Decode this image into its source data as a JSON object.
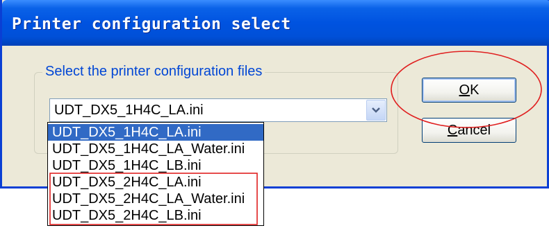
{
  "window": {
    "title": "Printer configuration select"
  },
  "group": {
    "legend": "Select the printer configuration files"
  },
  "combo": {
    "selected_value": "UDT_DX5_1H4C_LA.ini",
    "arrow_icon": "chevron-down-icon"
  },
  "dropdown": {
    "items": [
      {
        "label": "UDT_DX5_1H4C_LA.ini",
        "selected": true
      },
      {
        "label": "UDT_DX5_1H4C_LA_Water.ini",
        "selected": false
      },
      {
        "label": "UDT_DX5_1H4C_LB.ini",
        "selected": false
      },
      {
        "label": "UDT_DX5_2H4C_LA.ini",
        "selected": false
      },
      {
        "label": "UDT_DX5_2H4C_LA_Water.ini",
        "selected": false
      },
      {
        "label": "UDT_DX5_2H4C_LB.ini",
        "selected": false
      }
    ]
  },
  "buttons": {
    "ok": {
      "mnemonic": "O",
      "rest": "K"
    },
    "cancel": {
      "mnemonic": "C",
      "rest": "ancel"
    }
  },
  "colors": {
    "titlebar": "#0053e0",
    "selection": "#316ac5",
    "annotation": "#e02020",
    "legend_text": "#0046d5"
  }
}
